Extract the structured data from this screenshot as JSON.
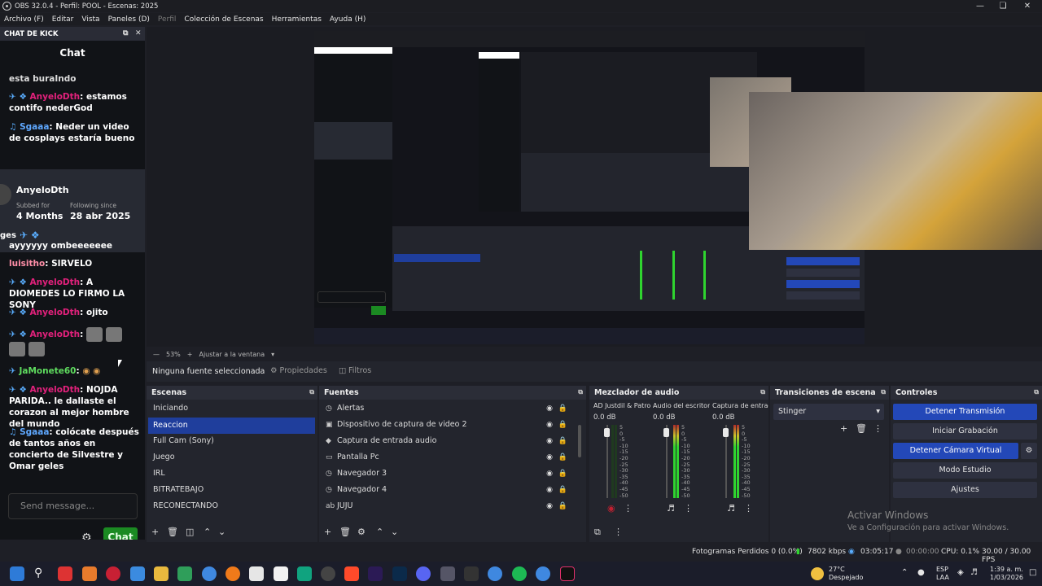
{
  "window": {
    "title": "OBS 32.0.4 - Perfil: POOL - Escenas: 2025"
  },
  "menu": [
    "Archivo (F)",
    "Editar",
    "Vista",
    "Paneles (D)",
    "Perfil",
    "Colección de Escenas",
    "Herramientas",
    "Ayuda (H)"
  ],
  "chat_dock": {
    "dock_title": "CHAT DE KICK",
    "header": "Chat",
    "partial_top": "esta buraIndo",
    "messages": [
      {
        "user": "AnyeloDth",
        "text": ": estamos contifo nederGod"
      },
      {
        "user": "Sgaaa",
        "text": ": Neder un video de cosplays estaría bueno"
      }
    ],
    "card": {
      "name": "AnyeloDth",
      "subbed_label": "Subbed for",
      "subbed_value": "4 Months",
      "following_label": "Following since",
      "following_value": "28 abr 2025",
      "badges_label": "ges"
    },
    "messages2": [
      {
        "user": "",
        "text": "ayyyyyy ombeeeeeee"
      },
      {
        "user": "luisitho",
        "text": ": SIRVELO"
      },
      {
        "user": "AnyeloDth",
        "text": ": A DIOMEDES LO FIRMO LA SONY"
      },
      {
        "user": "AnyeloDth",
        "text": ": ojito"
      },
      {
        "user": "AnyeloDth",
        "text": ":"
      },
      {
        "user": "JaMonete60",
        "text": ":"
      },
      {
        "user": "AnyeloDth",
        "text": ": NOJDA PARIDA.. le dallaste el corazon al mejor hombre del mundo"
      },
      {
        "user": "Sgaaa",
        "text": ": colócate después de tantos años en concierto de Silvestre y Omar geles"
      }
    ],
    "send_placeholder": "Send message...",
    "chat_button": "Chat"
  },
  "zoom": {
    "level": "53%",
    "fit": "Ajustar a la ventana"
  },
  "context": {
    "selected": "Ninguna fuente seleccionada",
    "properties": "Propiedades",
    "filters": "Filtros"
  },
  "scenes": {
    "title": "Escenas",
    "items": [
      "Iniciando",
      "Reaccion",
      "Full Cam (Sony)",
      "Juego",
      "IRL",
      "BITRATEBAJO",
      "RECONECTANDO"
    ],
    "selected_index": 1
  },
  "sources": {
    "title": "Fuentes",
    "items": [
      "Alertas",
      "Dispositivo de captura de video 2",
      "Captura de entrada audio",
      "Pantalla Pc",
      "Navegador 3",
      "Navegador 4",
      "JUJU"
    ]
  },
  "mixer": {
    "title": "Mezclador de audio",
    "channels": [
      {
        "name": "AD Justdil & Patroc",
        "db": "0.0 dB",
        "level": 0.0
      },
      {
        "name": "Audio del escritorio",
        "db": "0.0 dB",
        "level": 0.75
      },
      {
        "name": "Captura de entrada",
        "db": "0.0 dB",
        "level": 0.7
      }
    ],
    "scale": [
      "5",
      "0",
      "-5",
      "-10",
      "-15",
      "-20",
      "-25",
      "-30",
      "-35",
      "-40",
      "-45",
      "-50",
      "-55",
      "-60"
    ]
  },
  "transitions": {
    "title": "Transiciones de escena",
    "selected": "Stinger"
  },
  "controls": {
    "title": "Controles",
    "buttons": [
      "Detener Transmisión",
      "Iniciar Grabación",
      "Detener Cámara Virtual",
      "Modo Estudio",
      "Ajustes"
    ]
  },
  "watermark": {
    "line1": "Activar Windows",
    "line2": "Ve a Configuración para activar Windows."
  },
  "status": {
    "dropped": "Fotogramas Perdidos 0 (0.0%)",
    "kbps": "7802 kbps",
    "stream_time": "03:05:17",
    "rec_time": "00:00:00",
    "cpu": "CPU: 0.1%",
    "fps": "30.00 / 30.00 FPS"
  },
  "taskbar": {
    "temp": "27°C",
    "weather": "Despejado",
    "lang1": "ESP",
    "lang2": "LAA",
    "time": "1:39 a. m.",
    "date": "1/03/2026"
  }
}
